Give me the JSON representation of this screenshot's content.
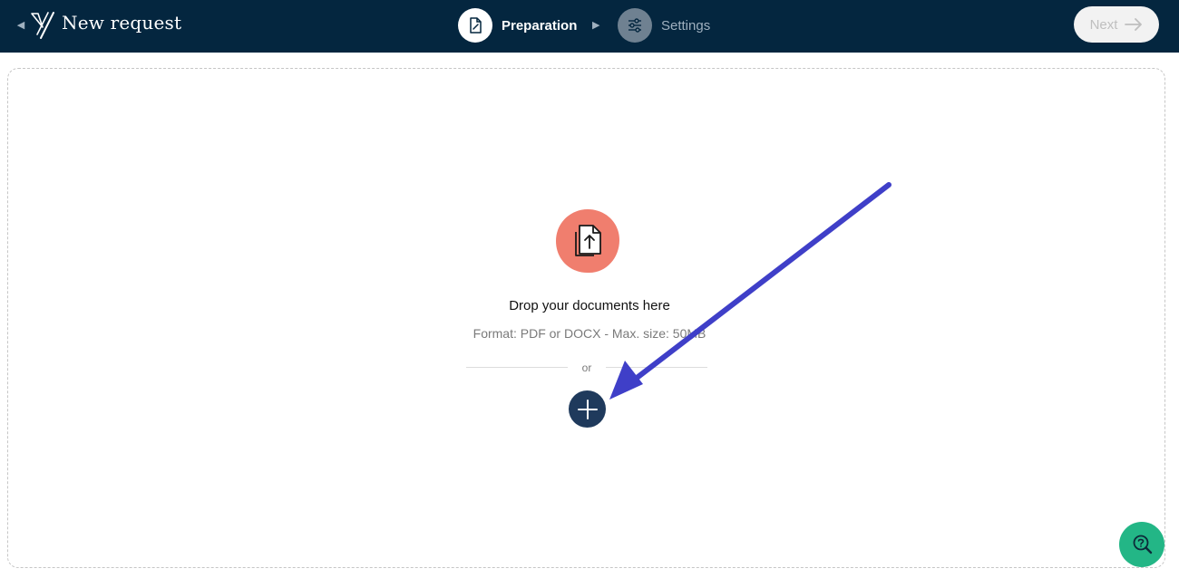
{
  "header": {
    "title": "New request",
    "steps": [
      {
        "label": "Preparation",
        "icon": "document-edit-icon",
        "active": true
      },
      {
        "label": "Settings",
        "icon": "sliders-icon",
        "active": false
      }
    ],
    "next_label": "Next"
  },
  "dropzone": {
    "heading": "Drop your documents here",
    "format_hint": "Format: PDF or DOCX - Max. size: 50MB",
    "or_text": "or"
  },
  "colors": {
    "header_bg": "#04263f",
    "upload_blob": "#f07e6e",
    "add_button": "#1f3a5c",
    "annotation_arrow": "#3f3fc8",
    "help_button": "#23b686"
  }
}
